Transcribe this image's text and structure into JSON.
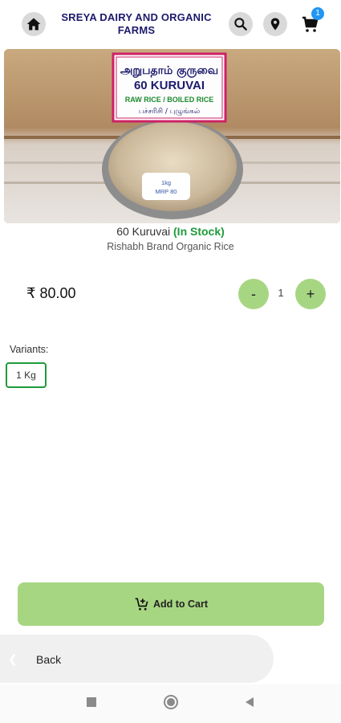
{
  "header": {
    "brand": "SREYA DAIRY AND ORGANIC FARMS",
    "cart_count": "1",
    "icons": [
      "home-icon",
      "search-icon",
      "location-pin-icon",
      "cart-icon"
    ]
  },
  "product": {
    "image_sign": {
      "tamil_title": "அறுபதாம் குருவை",
      "english_title": "60 KURUVAI",
      "subtitle": "RAW RICE / BOILED RICE",
      "tamil_subtitle": "பச்சரிசி / புழுங்கல்",
      "tag_line1": "1kg",
      "tag_line2": "MRP 80"
    },
    "name": "60 Kuruvai",
    "stock": "(In Stock)",
    "brand": "Rishabh Brand Organic Rice",
    "price": "₹ 80.00",
    "quantity": "1",
    "minus_label": "-",
    "plus_label": "+"
  },
  "variants": {
    "label": "Variants:",
    "items": [
      "1 Kg"
    ]
  },
  "actions": {
    "add_to_cart": "Add to Cart",
    "back": "Back"
  },
  "colors": {
    "accent_green": "#a7d683",
    "stock_green": "#1e9b3a",
    "brand_navy": "#1c1a6b",
    "badge_blue": "#2196f3"
  }
}
